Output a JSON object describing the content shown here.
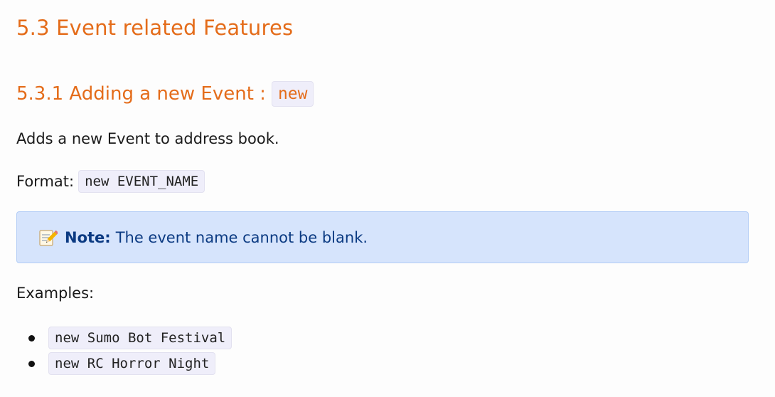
{
  "section": {
    "title": "5.3 Event related Features"
  },
  "subsection": {
    "title": "5.3.1 Adding a new Event :",
    "command": "new"
  },
  "description": "Adds a new Event to address book.",
  "format": {
    "label": "Format:",
    "code": "new EVENT_NAME"
  },
  "note": {
    "icon": "memo-icon",
    "label": "Note:",
    "text": "The event name cannot be blank."
  },
  "examples": {
    "label": "Examples:",
    "items": [
      "new Sumo Bot Festival",
      "new RC Horror Night"
    ]
  },
  "colors": {
    "heading": "#e46c1a",
    "note_background": "#d6e4fc",
    "note_text": "#0b3a82",
    "code_background": "#efeefa"
  }
}
